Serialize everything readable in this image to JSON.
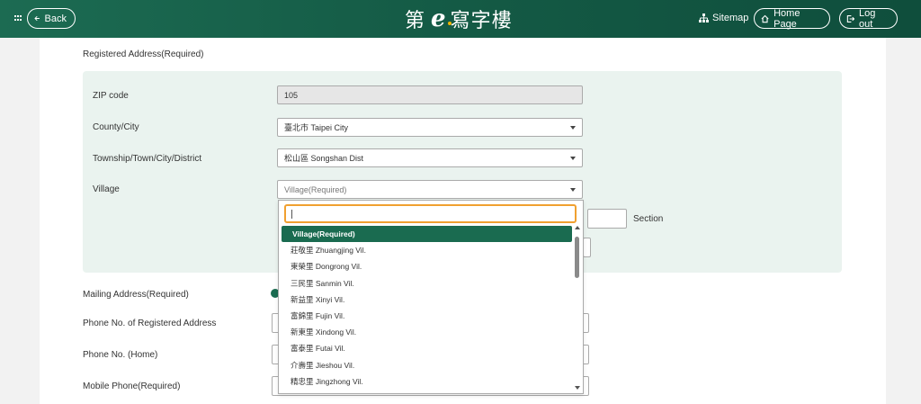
{
  "header": {
    "back_label": "Back",
    "logo_left": "第",
    "logo_e": "e",
    "logo_right": "寫字樓",
    "sitemap_label": "Sitemap",
    "home_label": "Home Page",
    "logout_label": "Log out"
  },
  "form": {
    "registered_address_title": "Registered Address(Required)",
    "zip_label": "ZIP code",
    "zip_value": "105",
    "county_label": "County/City",
    "county_value": "臺北市 Taipei City",
    "township_label": "Township/Town/City/District",
    "township_value": "松山區 Songshan Dist",
    "village_label": "Village",
    "village_placeholder": "Village(Required)",
    "section_label": "Section",
    "mailing_label": "Mailing Address(Required)",
    "phone_registered_label": "Phone No. of Registered Address",
    "phone_home_label": "Phone No. (Home)",
    "mobile_label": "Mobile Phone(Required)"
  },
  "dropdown": {
    "search_value": "",
    "options": [
      "Village(Required)",
      "莊敬里 Zhuangjing Vil.",
      "東榮里 Dongrong Vil.",
      "三民里 Sanmin Vil.",
      "新益里 Xinyi Vil.",
      "富錦里 Fujin Vil.",
      "新東里 Xindong Vil.",
      "富泰里 Futai Vil.",
      "介壽里 Jieshou Vil.",
      "精忠里 Jingzhong Vil."
    ],
    "selected_index": 0
  },
  "colors": {
    "header_green": "#145a45",
    "accent_green": "#1a6b50",
    "focus_orange": "#f0a030",
    "address_bg": "#eaf3ef"
  }
}
